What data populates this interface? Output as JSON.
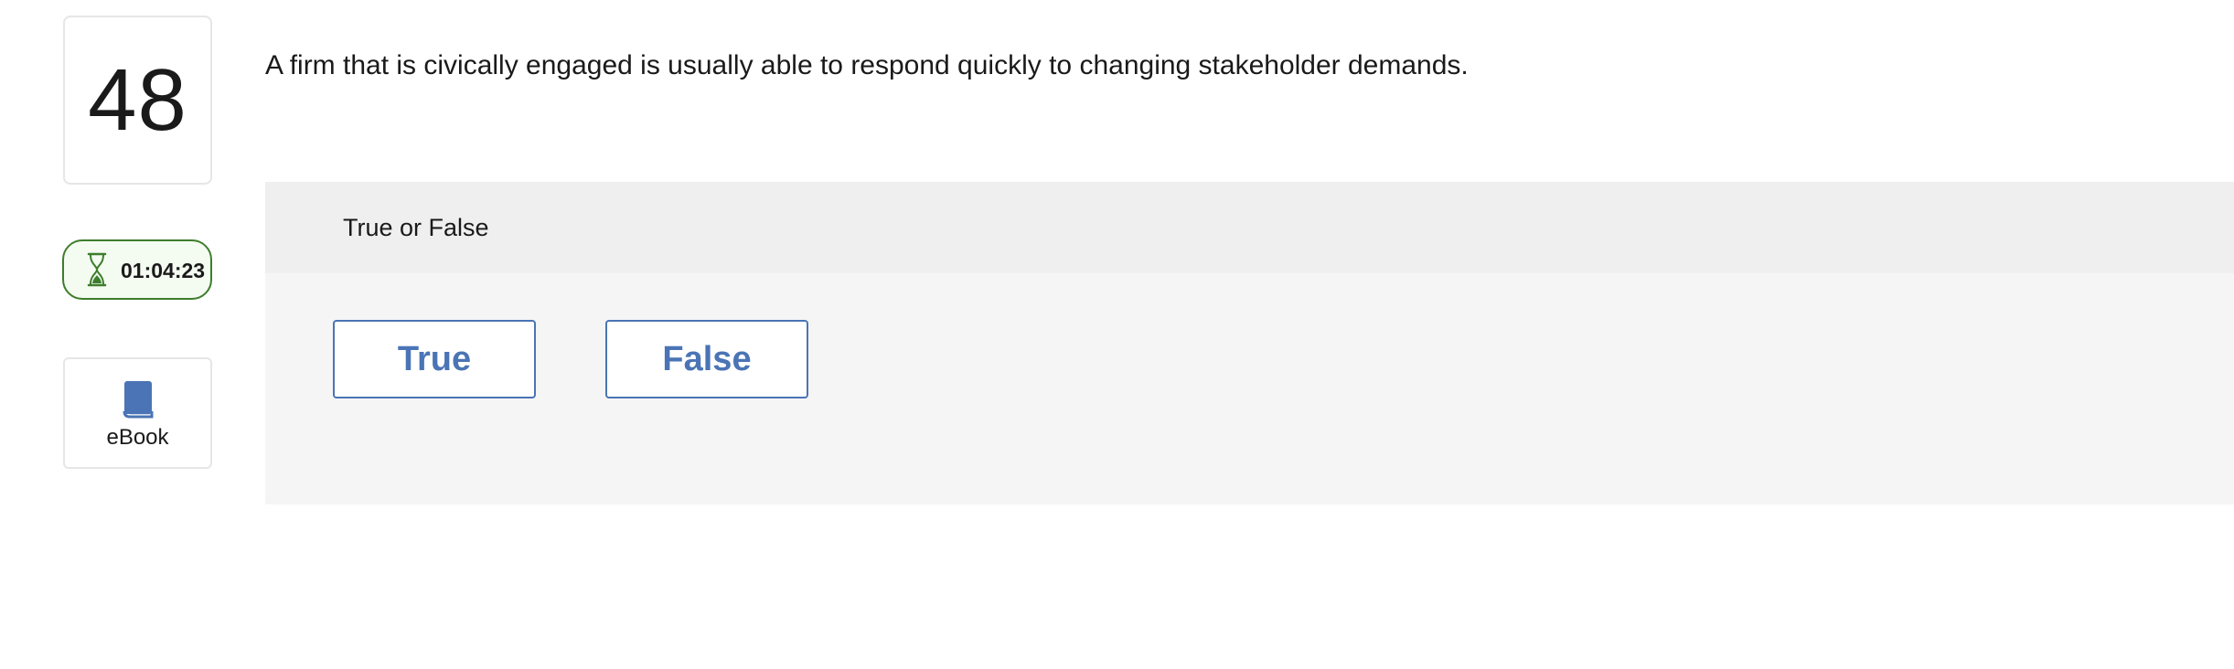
{
  "question": {
    "number": "48",
    "text": "A firm that is civically engaged is usually able to respond quickly to changing stakeholder demands."
  },
  "timer": {
    "icon": "hourglass-icon",
    "time": "01:04:23",
    "color": "#3e7d2c"
  },
  "ebook": {
    "icon": "book-icon",
    "label": "eBook",
    "color": "#4a74b5"
  },
  "answer_panel": {
    "type_label": "True or False",
    "choices": [
      {
        "label": "True"
      },
      {
        "label": "False"
      }
    ],
    "accent": "#4a74b5"
  }
}
